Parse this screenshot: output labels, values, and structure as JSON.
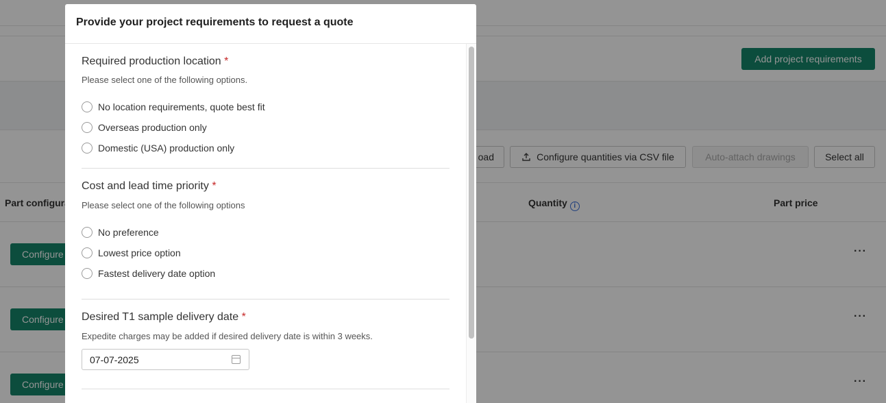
{
  "background": {
    "add_requirements_label": "Add project requirements",
    "toolbar": {
      "download_partial_label": "oad",
      "configure_csv_label": "Configure quantities via CSV file",
      "auto_attach_label": "Auto-attach drawings",
      "select_all_label": "Select all"
    },
    "table_headers": {
      "part_configuration": "Part configura",
      "quantity": "Quantity",
      "part_price": "Part price"
    },
    "row_button_label": "Configure",
    "more_label": "···"
  },
  "modal": {
    "title": "Provide your project requirements to request a quote",
    "location": {
      "title": "Required production location",
      "required_mark": "*",
      "help": "Please select one of the following options.",
      "options": [
        "No location requirements, quote best fit",
        "Overseas production only",
        "Domestic (USA) production only"
      ]
    },
    "priority": {
      "title": "Cost and lead time priority",
      "required_mark": "*",
      "help": "Please select one of the following options",
      "options": [
        "No preference",
        "Lowest price option",
        "Fastest delivery date option"
      ]
    },
    "delivery": {
      "title": "Desired T1 sample delivery date",
      "required_mark": "*",
      "help": "Expedite charges may be added if desired delivery date is within 3 weeks.",
      "date_value": "07-07-2025"
    }
  },
  "colors": {
    "primary": "#15866a",
    "required": "#c62828",
    "info": "#3a6fd8"
  }
}
